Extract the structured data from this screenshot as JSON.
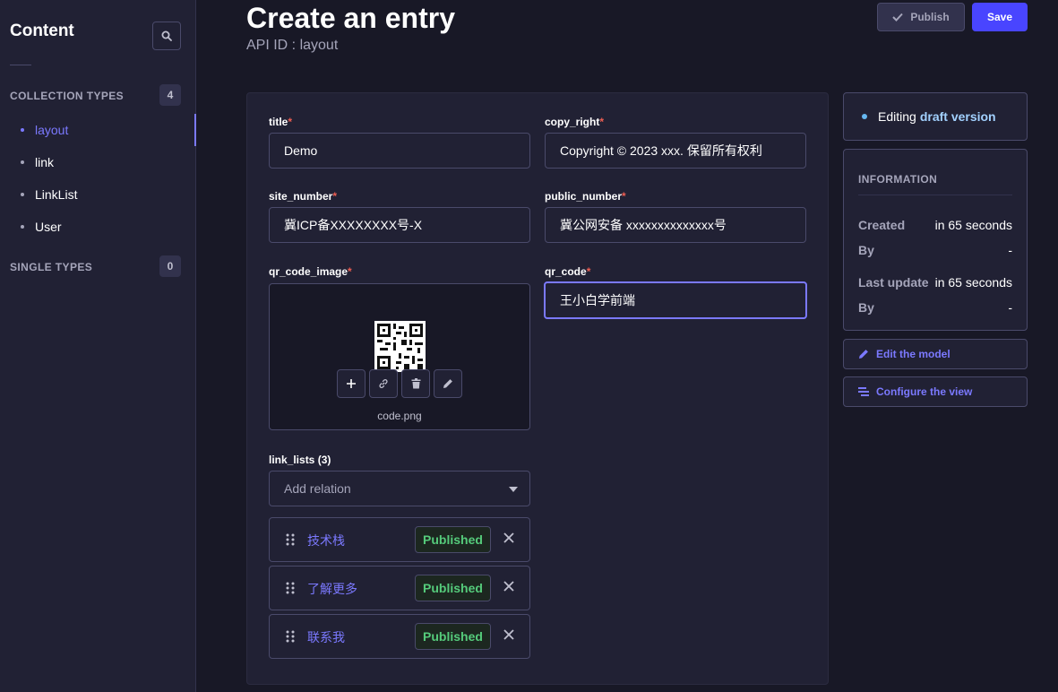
{
  "sidebar": {
    "title": "Content",
    "collection_types": {
      "label": "COLLECTION TYPES",
      "count": "4"
    },
    "items": [
      {
        "label": "layout",
        "active": true
      },
      {
        "label": "link"
      },
      {
        "label": "LinkList"
      },
      {
        "label": "User"
      }
    ],
    "single_types": {
      "label": "SINGLE TYPES",
      "count": "0"
    }
  },
  "header": {
    "title": "Create an entry",
    "subtitle": "API ID : layout",
    "publish_label": "Publish",
    "save_label": "Save"
  },
  "form": {
    "title": {
      "label": "title",
      "value": "Demo"
    },
    "copy_right": {
      "label": "copy_right",
      "value": "Copyright © 2023 xxx. 保留所有权利"
    },
    "site_number": {
      "label": "site_number",
      "value": "冀ICP备XXXXXXXX号-X"
    },
    "public_number": {
      "label": "public_number",
      "value": "冀公网安备 xxxxxxxxxxxxxx号"
    },
    "qr_code_image": {
      "label": "qr_code_image",
      "filename": "code.png"
    },
    "qr_code": {
      "label": "qr_code",
      "value": "王小白学前端"
    },
    "link_lists": {
      "label": "link_lists (3)",
      "placeholder": "Add relation",
      "items": [
        {
          "name": "技术栈",
          "status": "Published"
        },
        {
          "name": "了解更多",
          "status": "Published"
        },
        {
          "name": "联系我",
          "status": "Published"
        }
      ]
    }
  },
  "editing": {
    "prefix": "Editing",
    "version": "draft version"
  },
  "information": {
    "heading": "INFORMATION",
    "created_label": "Created",
    "created_value": "in 65 seconds",
    "by_label": "By",
    "by_value": "-",
    "updated_label": "Last update",
    "updated_value": "in 65 seconds",
    "by2_label": "By",
    "by2_value": "-"
  },
  "actions": {
    "edit_model": "Edit the model",
    "configure_view": "Configure the view"
  },
  "colors": {
    "primary": "#4945ff",
    "accent": "#7b79ff",
    "success": "#55cb7b",
    "required": "#ee5e52"
  }
}
